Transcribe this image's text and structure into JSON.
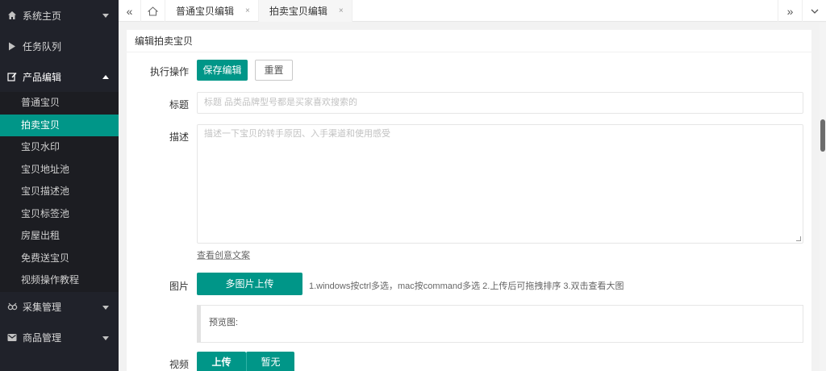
{
  "sidebar": {
    "groups": [
      {
        "label": "系统主页",
        "icon": "home-icon"
      },
      {
        "label": "任务队列",
        "icon": "play-icon"
      },
      {
        "label": "产品编辑",
        "icon": "edit-icon"
      },
      {
        "label": "采集管理",
        "icon": "collect-icon"
      },
      {
        "label": "商品管理",
        "icon": "mail-icon"
      }
    ],
    "items": [
      {
        "label": "普通宝贝"
      },
      {
        "label": "拍卖宝贝"
      },
      {
        "label": "宝贝水印"
      },
      {
        "label": "宝贝地址池"
      },
      {
        "label": "宝贝描述池"
      },
      {
        "label": "宝贝标签池"
      },
      {
        "label": "房屋出租"
      },
      {
        "label": "免费送宝贝"
      },
      {
        "label": "视频操作教程"
      }
    ]
  },
  "tabs": [
    {
      "label": "普通宝贝编辑",
      "close": "×"
    },
    {
      "label": "拍卖宝贝编辑",
      "close": "×"
    }
  ],
  "tabbar": {
    "prev": "«",
    "next": "»"
  },
  "form": {
    "card_title": "编辑拍卖宝贝",
    "action_label": "执行操作",
    "save_label": "保存编辑",
    "reset_label": "重置",
    "title_label": "标题",
    "title_placeholder": "标题 品类品牌型号都是买家喜欢搜索的",
    "desc_label": "描述",
    "desc_placeholder": "描述一下宝贝的转手原因、入手渠道和使用感受",
    "creative_link": "查看创意文案",
    "image_label": "图片",
    "upload_multi_label": "多图片上传",
    "image_hint": "1.windows按ctrl多选，mac按command多选  2.上传后可拖拽排序  3.双击查看大图",
    "preview_label": "预览图:",
    "video_label": "视频",
    "upload_label": "上传",
    "none_label": "暂无"
  },
  "colors": {
    "accent": "#009688",
    "sidebar_bg": "#20222a"
  }
}
